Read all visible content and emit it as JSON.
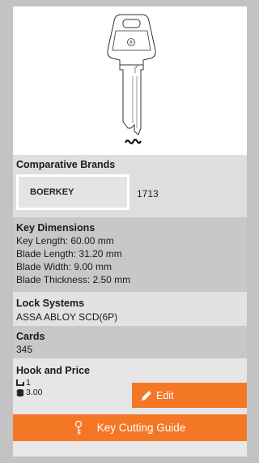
{
  "brands": {
    "title": "Comparative Brands",
    "items": [
      {
        "name": "BOERKEY",
        "number": "1713"
      }
    ]
  },
  "dimensions": {
    "title": "Key Dimensions",
    "lines": [
      "Key Length: 60.00 mm",
      "Blade Length: 31.20 mm",
      "Blade Width: 9.00 mm",
      "Blade Thickness: 2.50 mm"
    ]
  },
  "lock_systems": {
    "title": "Lock Systems",
    "value": "ASSA ABLOY SCD(6P)"
  },
  "cards": {
    "title": "Cards",
    "value": "345"
  },
  "hook_price": {
    "title": "Hook and Price",
    "hook": "1",
    "price": "3.00",
    "hook_icon": "hook-icon",
    "price_icon": "coins-icon",
    "edit_label": "Edit",
    "edit_icon": "pencil-icon"
  },
  "guide_button": {
    "label": "Key Cutting Guide",
    "icon": "key-icon"
  },
  "colors": {
    "accent": "#f47726",
    "page_background": "#c3c3c3"
  }
}
